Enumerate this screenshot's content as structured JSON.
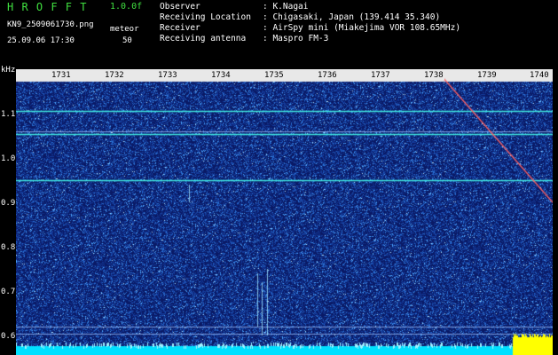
{
  "header": {
    "app_title": "H R O F F T",
    "app_version": "1.0.0f",
    "file_name": "KN9_2509061730.png",
    "mode_label": "meteor",
    "timestamp": "25.09.06 17:30",
    "mode_value": "50",
    "info_rows": [
      {
        "label": "Observer",
        "value": ": K.Nagai"
      },
      {
        "label": "Receiving Location",
        "value": ": Chigasaki, Japan (139.414 35.340)"
      },
      {
        "label": "Receiver",
        "value": ": AirSpy mini (Miakejima VOR 108.65MHz)"
      },
      {
        "label": "Receiving antenna",
        "value": ": Maspro FM-3"
      }
    ]
  },
  "y_axis": {
    "unit": "kHz",
    "ticks": [
      "1.1",
      "1.0",
      "0.9",
      "0.8",
      "0.7",
      "0.6"
    ]
  },
  "x_axis": {
    "ticks": [
      "1731",
      "1732",
      "1733",
      "1734",
      "1735",
      "1736",
      "1737",
      "1738",
      "1739",
      "1740"
    ]
  },
  "colors": {
    "background": "#000000",
    "plot_background": "#0a1a66",
    "noise_low": "#143c9c",
    "noise_high": "#40a0ff",
    "carrier": "#40e8e0",
    "header_green": "#40e040",
    "bottom_band": "#00e0ff",
    "bottom_peak": "#ffff00",
    "meteor_trail": "#ff6060"
  }
}
